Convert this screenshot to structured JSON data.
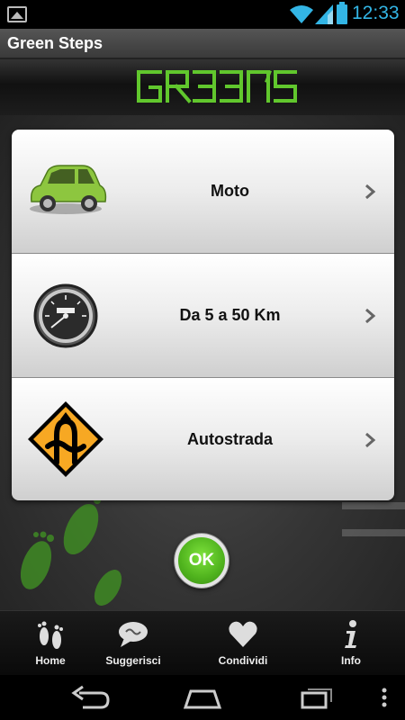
{
  "status_bar": {
    "time": "12:33"
  },
  "action_bar": {
    "title": "Green Steps"
  },
  "logo": {
    "text": "GREENS'",
    "color": "#61c72d"
  },
  "options": [
    {
      "label": "Moto",
      "icon": "car-icon"
    },
    {
      "label": "Da 5 a 50 Km",
      "icon": "speedometer-icon"
    },
    {
      "label": "Autostrada",
      "icon": "road-sign-icon"
    }
  ],
  "ok_button": {
    "label": "OK"
  },
  "tabs": [
    {
      "label": "Home",
      "icon": "footprints-icon"
    },
    {
      "label": "Suggerisci",
      "icon": "speech-bubble-icon"
    },
    {
      "label": "Condividi",
      "icon": "heart-icon"
    },
    {
      "label": "Info",
      "icon": "info-icon"
    }
  ],
  "colors": {
    "accent": "#33b5e5",
    "brand_green": "#61c72d"
  }
}
